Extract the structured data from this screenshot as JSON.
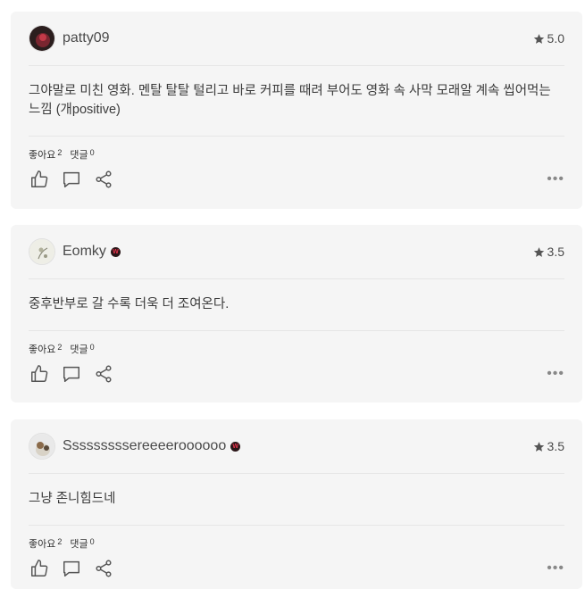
{
  "reviews": [
    {
      "username": "patty09",
      "has_badge": false,
      "rating": "5.0",
      "text": "그야말로 미친 영화. 멘탈 탈탈 털리고 바로 커피를 때려 부어도 영화 속 사막 모래알 계속 씹어먹는 느낌 (개positive)",
      "likes_label": "좋아요",
      "likes_count": "2",
      "comments_label": "댓글",
      "comments_count": "0"
    },
    {
      "username": "Eomky",
      "has_badge": true,
      "rating": "3.5",
      "text": "중후반부로 갈 수록 더욱 더 조여온다.",
      "likes_label": "좋아요",
      "likes_count": "2",
      "comments_label": "댓글",
      "comments_count": "0"
    },
    {
      "username": "Sssssssssereeeeroooooo",
      "has_badge": true,
      "rating": "3.5",
      "text": "그냥 존니힘드네",
      "likes_label": "좋아요",
      "likes_count": "2",
      "comments_label": "댓글",
      "comments_count": "0"
    }
  ],
  "badge_letter": "W",
  "colors": {
    "card_bg": "#f5f5f5",
    "badge": "#e8324b",
    "text": "#3a3a3a"
  },
  "icons": [
    "star-icon",
    "thumbs-up-icon",
    "comment-icon",
    "share-icon",
    "more-icon"
  ]
}
